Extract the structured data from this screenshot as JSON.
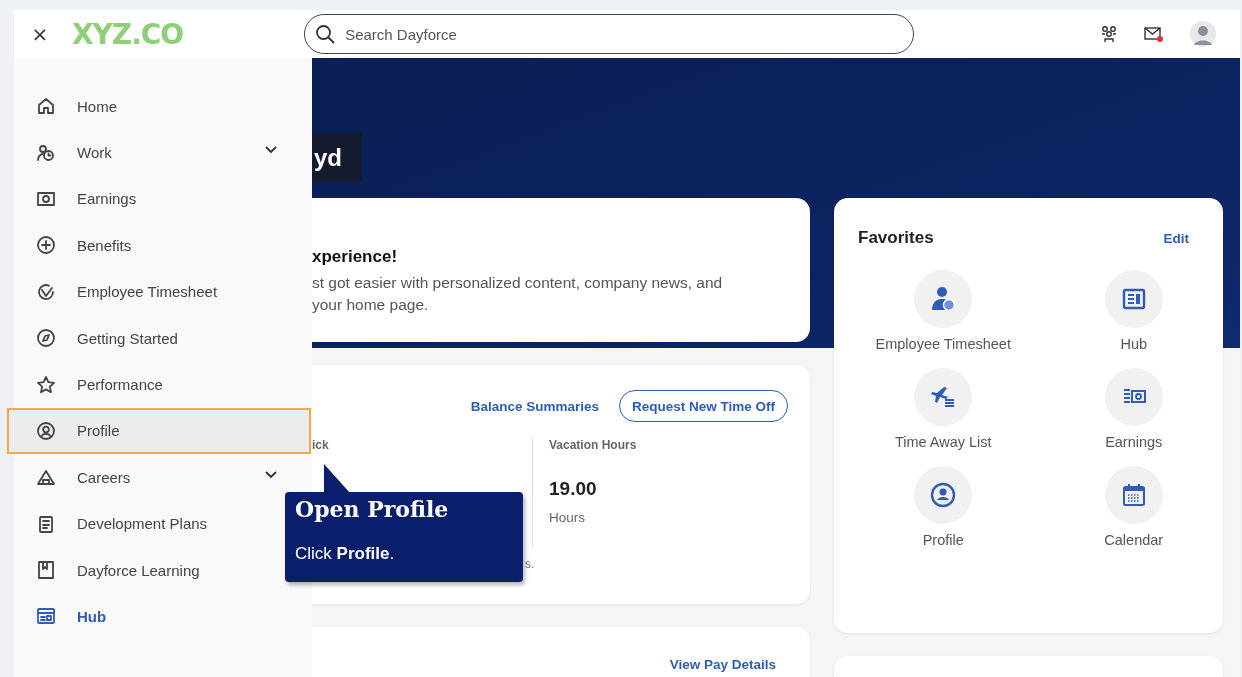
{
  "top_bar": {
    "close": "×",
    "logo": "XYZ.CO",
    "search": {
      "placeholder": "Search Dayforce"
    },
    "mail_unread": true
  },
  "sidebar": {
    "items": [
      {
        "label": "Home",
        "selected": false,
        "highlighted": false,
        "submenu": false
      },
      {
        "label": "Work",
        "selected": false,
        "highlighted": false,
        "submenu": true
      },
      {
        "label": "Earnings",
        "selected": false,
        "highlighted": false,
        "submenu": false
      },
      {
        "label": "Benefits",
        "selected": false,
        "highlighted": false,
        "submenu": false
      },
      {
        "label": "Employee Timesheet",
        "selected": false,
        "highlighted": false,
        "submenu": false
      },
      {
        "label": "Getting Started",
        "selected": false,
        "highlighted": false,
        "submenu": false
      },
      {
        "label": "Performance",
        "selected": false,
        "highlighted": false,
        "submenu": false
      },
      {
        "label": "Profile",
        "selected": false,
        "highlighted": true,
        "submenu": false
      },
      {
        "label": "Careers",
        "selected": false,
        "highlighted": false,
        "submenu": true
      },
      {
        "label": "Development Plans",
        "selected": false,
        "highlighted": false,
        "submenu": false
      },
      {
        "label": "Dayforce Learning",
        "selected": false,
        "highlighted": false,
        "submenu": false
      },
      {
        "label": "Hub",
        "selected": true,
        "highlighted": false,
        "submenu": false
      }
    ]
  },
  "banner": {
    "greeting": "yd"
  },
  "welcome_card": {
    "title": "xperience!",
    "text": "st got easier with personalized content, company news, and your home page."
  },
  "time_off_card": {
    "balance_link": "Balance Summaries",
    "request_button": "Request New Time Off",
    "balances": [
      {
        "label": "ick"
      },
      {
        "label": "Vacation Hours",
        "value": "19.00",
        "unit": "Hours"
      }
    ],
    "note": "s."
  },
  "pay_card": {
    "link": "View Pay Details"
  },
  "favorites": {
    "title": "Favorites",
    "edit": "Edit",
    "items": [
      "Employee Timesheet",
      "Hub",
      "Time Away List",
      "Earnings",
      "Profile",
      "Calendar"
    ]
  },
  "tooltip": {
    "title": "Open Profile",
    "text": "Click **Profile**."
  }
}
